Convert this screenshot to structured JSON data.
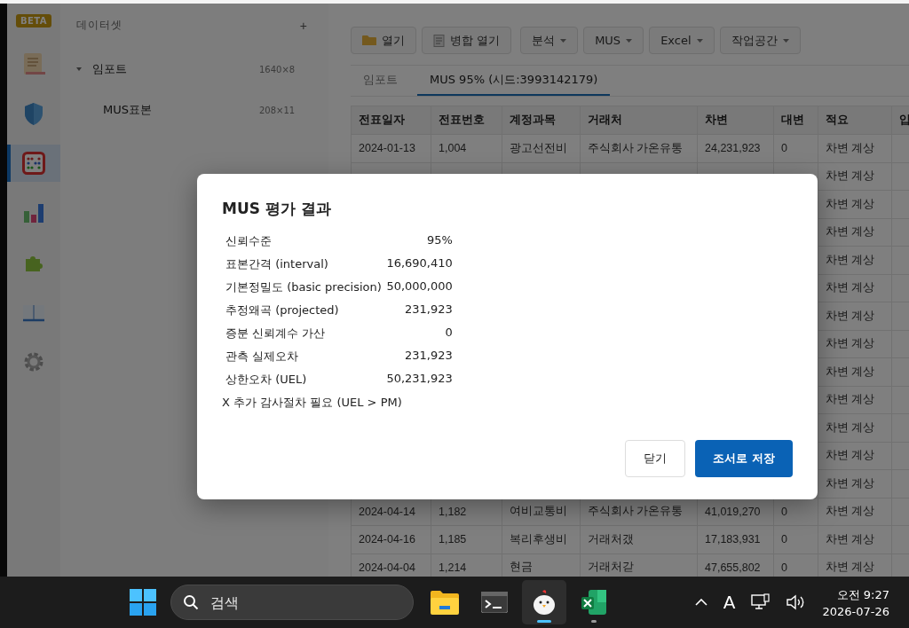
{
  "rail": {
    "badge": "BETA",
    "items": [
      {
        "kind": "scroll",
        "selected": false
      },
      {
        "kind": "shield",
        "selected": false
      },
      {
        "kind": "abacus",
        "selected": true
      },
      {
        "kind": "chart",
        "selected": false
      },
      {
        "kind": "puzzle",
        "selected": false
      },
      {
        "kind": "book",
        "selected": false
      },
      {
        "kind": "gear",
        "selected": false
      }
    ]
  },
  "datasets": {
    "title": "데이터셋",
    "add": "+",
    "items": [
      {
        "name": "임포트",
        "size": "1640×8",
        "expanded": true,
        "children": [
          {
            "name": "MUS표본",
            "size": "208×11"
          }
        ]
      }
    ]
  },
  "toolbar": [
    {
      "label": "열기",
      "kind": "folder"
    },
    {
      "label": "병합 열기",
      "kind": "merge"
    },
    {
      "label": "분석",
      "kind": "menu"
    },
    {
      "label": "MUS",
      "kind": "menu"
    },
    {
      "label": "Excel",
      "kind": "menu"
    },
    {
      "label": "작업공간",
      "kind": "menu"
    }
  ],
  "tabs": [
    {
      "label": "임포트",
      "selected": false
    },
    {
      "label": "MUS 95% (시드:3993142179)",
      "selected": true
    }
  ],
  "table": {
    "columns": [
      "전표일자",
      "전표번호",
      "계정과목",
      "거래처",
      "차변",
      "대변",
      "적요",
      "입"
    ],
    "rows": [
      {
        "cells": [
          "2024-01-13",
          "1,004",
          "광고선전비",
          "주식회사 가온유통",
          "24,231,923",
          "0",
          "차변 계상"
        ]
      },
      {
        "cells": [
          "차변 계상"
        ]
      },
      {
        "cells": [
          "차변 계상"
        ]
      },
      {
        "cells": [
          "차변 계상"
        ]
      },
      {
        "cells": [
          "차변 계상"
        ]
      },
      {
        "cells": [
          "차변 계상"
        ]
      },
      {
        "cells": [
          "차변 계상"
        ]
      },
      {
        "cells": [
          "차변 계상"
        ]
      },
      {
        "cells": [
          "차변 계상"
        ]
      },
      {
        "cells": [
          "차변 계상"
        ]
      },
      {
        "cells": [
          "차변 계상"
        ]
      },
      {
        "cells": [
          "차변 계상"
        ]
      },
      {
        "cells": [
          "차변 계상"
        ]
      },
      {
        "cells": [
          "2024-04-14",
          "1,182",
          "여비교통비",
          "주식회사 가온유통",
          "41,019,270",
          "0",
          "차변 계상"
        ]
      },
      {
        "cells": [
          "2024-04-16",
          "1,185",
          "복리후생비",
          "거래처갰",
          "17,183,931",
          "0",
          "차변 계상"
        ]
      },
      {
        "cells": [
          "2024-04-04",
          "1,214",
          "현금",
          "거래처갇",
          "47,655,802",
          "0",
          "차변 계상"
        ]
      }
    ]
  },
  "dialog": {
    "title": "MUS 평가 결과",
    "results": [
      {
        "label": "신뢰수준",
        "value": "95%"
      },
      {
        "label": "표본간격 (interval)",
        "value": "16,690,410"
      },
      {
        "label": "기본정밀도 (basic precision)",
        "value": "50,000,000"
      },
      {
        "label": "추정왜곡 (projected)",
        "value": "231,923"
      },
      {
        "label": "증분 신뢰계수 가산",
        "value": "0"
      },
      {
        "label": "관측 실제오차",
        "value": "231,923"
      },
      {
        "label": "상한오차 (UEL)",
        "value": "50,231,923"
      }
    ],
    "conclusion": "X 추가 감사절차 필요 (UEL > PM)",
    "buttons": [
      {
        "label": "닫기",
        "kind": "secondary"
      },
      {
        "label": "조서로 저장",
        "kind": "primary"
      }
    ]
  },
  "taskbar": {
    "search": {
      "placeholder": "검색"
    },
    "apps": [
      {
        "kind": "folder",
        "selected": false,
        "running": false
      },
      {
        "kind": "terminal",
        "selected": false,
        "running": false
      },
      {
        "kind": "chick",
        "selected": true,
        "running": true
      },
      {
        "kind": "excel",
        "selected": false,
        "running": true
      }
    ],
    "tray": {
      "ime": "A",
      "time": "오전 9:27",
      "date": "2026-07-26"
    }
  }
}
